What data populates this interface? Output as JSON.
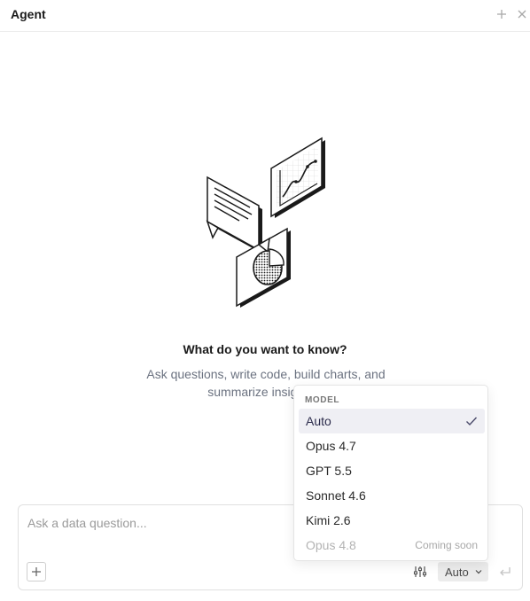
{
  "header": {
    "title": "Agent",
    "add_icon": "plus-icon",
    "close_icon": "close-icon"
  },
  "empty_state": {
    "illustration_icon": "data-insights-illustration",
    "title": "What do you want to know?",
    "description": "Ask questions, write code, build charts, and summarize insights. I"
  },
  "composer": {
    "placeholder": "Ask a data question...",
    "value": "",
    "attach_icon": "plus-icon",
    "settings_icon": "sliders-icon",
    "model_label": "Auto",
    "model_chevron_icon": "chevron-down-icon",
    "send_icon": "enter-return-icon"
  },
  "model_menu": {
    "section_label": "MODEL",
    "items": [
      {
        "label": "Auto",
        "selected": true,
        "disabled": false,
        "note": ""
      },
      {
        "label": "Opus 4.7",
        "selected": false,
        "disabled": false,
        "note": ""
      },
      {
        "label": "GPT 5.5",
        "selected": false,
        "disabled": false,
        "note": ""
      },
      {
        "label": "Sonnet 4.6",
        "selected": false,
        "disabled": false,
        "note": ""
      },
      {
        "label": "Kimi 2.6",
        "selected": false,
        "disabled": false,
        "note": ""
      },
      {
        "label": "Opus 4.8",
        "selected": false,
        "disabled": true,
        "note": "Coming soon"
      }
    ]
  },
  "colors": {
    "selected_bg": "#efeff4",
    "check": "#4a4a6a",
    "muted_text": "#6b7280",
    "border": "#e0e0e0"
  }
}
